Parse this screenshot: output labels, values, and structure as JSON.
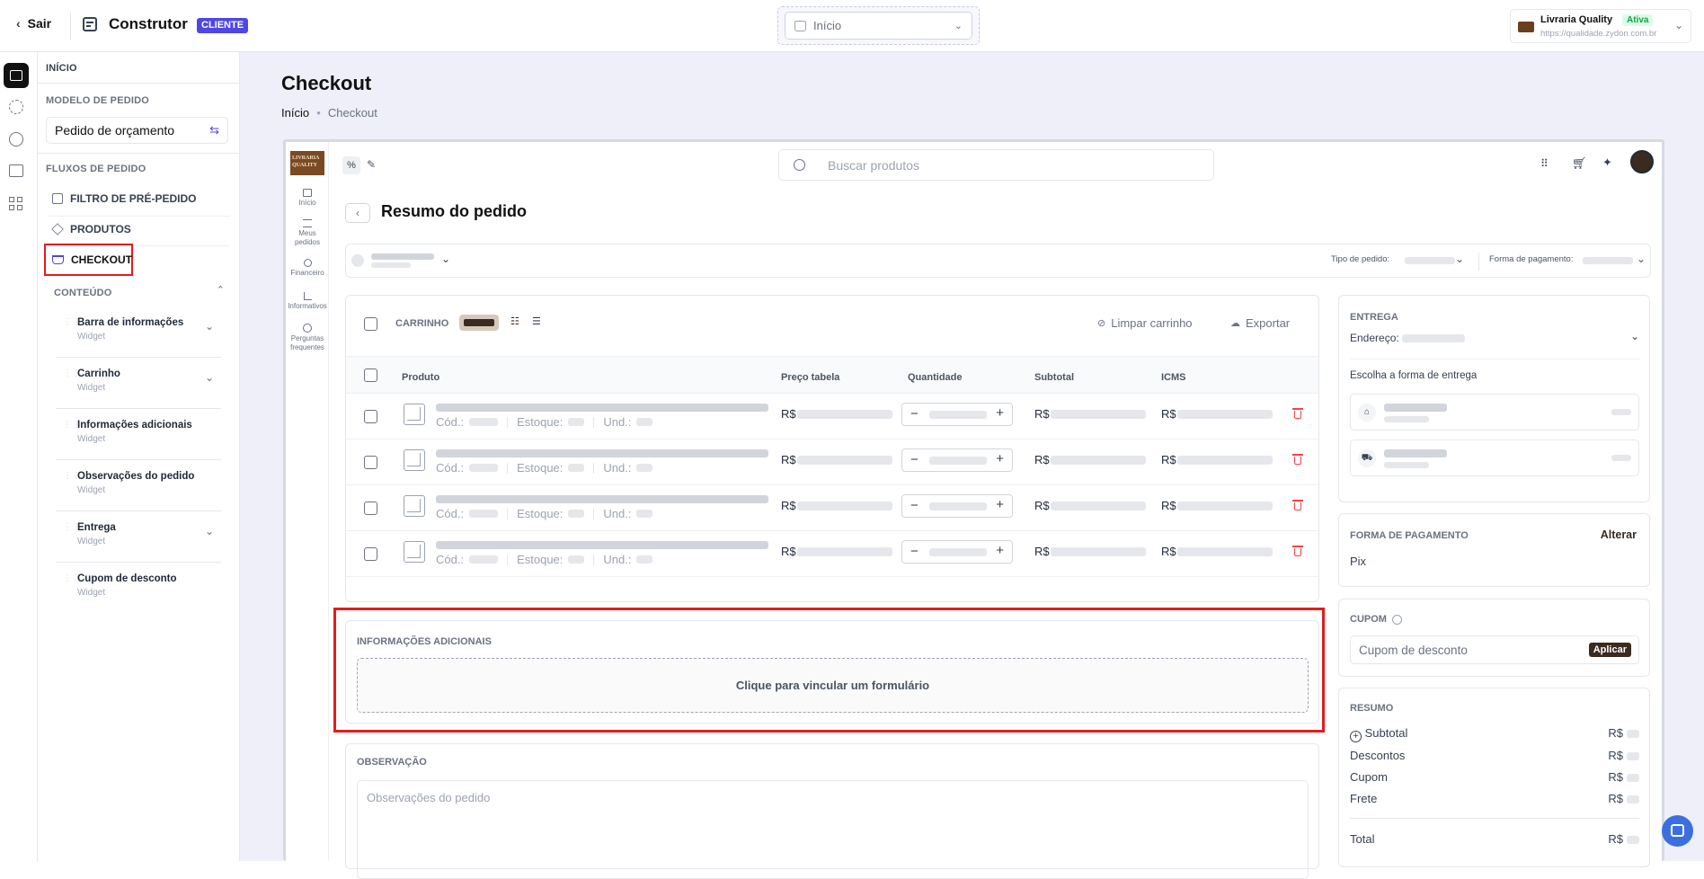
{
  "topbar": {
    "back_label": "Sair",
    "title": "Construtor",
    "badge": "CLIENTE",
    "page_select": "Início",
    "store_name": "Livraria Quality",
    "store_status": "Ativa",
    "store_url": "https://qualidade.zydon.com.br"
  },
  "sidebar": {
    "inicio": "INÍCIO",
    "modelo_header": "MODELO DE PEDIDO",
    "modelo_value": "Pedido de orçamento",
    "fluxos_header": "FLUXOS DE PEDIDO",
    "items": [
      {
        "label": "FILTRO DE PRÉ-PEDIDO"
      },
      {
        "label": "PRODUTOS"
      },
      {
        "label": "CHECKOUT"
      }
    ],
    "conteudo_header": "CONTEÚDO",
    "widgets": [
      {
        "title": "Barra de informações",
        "sub": "Widget"
      },
      {
        "title": "Carrinho",
        "sub": "Widget"
      },
      {
        "title": "Informações adicionais",
        "sub": "Widget"
      },
      {
        "title": "Observações do pedido",
        "sub": "Widget"
      },
      {
        "title": "Entrega",
        "sub": "Widget"
      },
      {
        "title": "Cupom de desconto",
        "sub": "Widget"
      }
    ]
  },
  "page": {
    "title": "Checkout",
    "breadcrumb_home": "Início",
    "breadcrumb_current": "Checkout"
  },
  "preview": {
    "logo_text": "LIVRARIA QUALITY",
    "search_placeholder": "Buscar produtos",
    "nav": [
      {
        "label": "Início"
      },
      {
        "label": "Meus pedidos"
      },
      {
        "label": "Financeiro"
      },
      {
        "label": "Informativos"
      },
      {
        "label": "Perguntas frequentes"
      }
    ],
    "order_title": "Resumo do pedido",
    "tipo_label": "Tipo de pedido:",
    "forma_label": "Forma de pagamento:",
    "cart": {
      "label": "CARRINHO",
      "clear": "Limpar carrinho",
      "export": "Exportar",
      "headers": [
        "Produto",
        "Preço tabela",
        "Quantidade",
        "Subtotal",
        "ICMS"
      ],
      "cod": "Cód.:",
      "estoque": "Estoque:",
      "und": "Und.:",
      "currency": "R$",
      "rows": 4
    },
    "info": {
      "header": "INFORMAÇÕES ADICIONAIS",
      "link_text": "Clique para vincular um formulário"
    },
    "obs": {
      "header": "OBSERVAÇÃO",
      "placeholder": "Observações do pedido"
    },
    "entrega": {
      "header": "ENTREGA",
      "endereco": "Endereço:",
      "choose": "Escolha a forma de entrega"
    },
    "pagamento": {
      "header": "FORMA DE PAGAMENTO",
      "change": "Alterar",
      "value": "Pix"
    },
    "cupom": {
      "header": "CUPOM",
      "placeholder": "Cupom de desconto",
      "apply": "Aplicar"
    },
    "resumo": {
      "header": "RESUMO",
      "subtotal": "Subtotal",
      "descontos": "Descontos",
      "cupom": "Cupom",
      "frete": "Frete",
      "total": "Total",
      "currency": "R$"
    }
  },
  "colors": {
    "accent": "#4f46e5",
    "highlight": "#e11d1d",
    "brown": "#3b2a1e",
    "canvas_bg": "#eeeff9"
  }
}
